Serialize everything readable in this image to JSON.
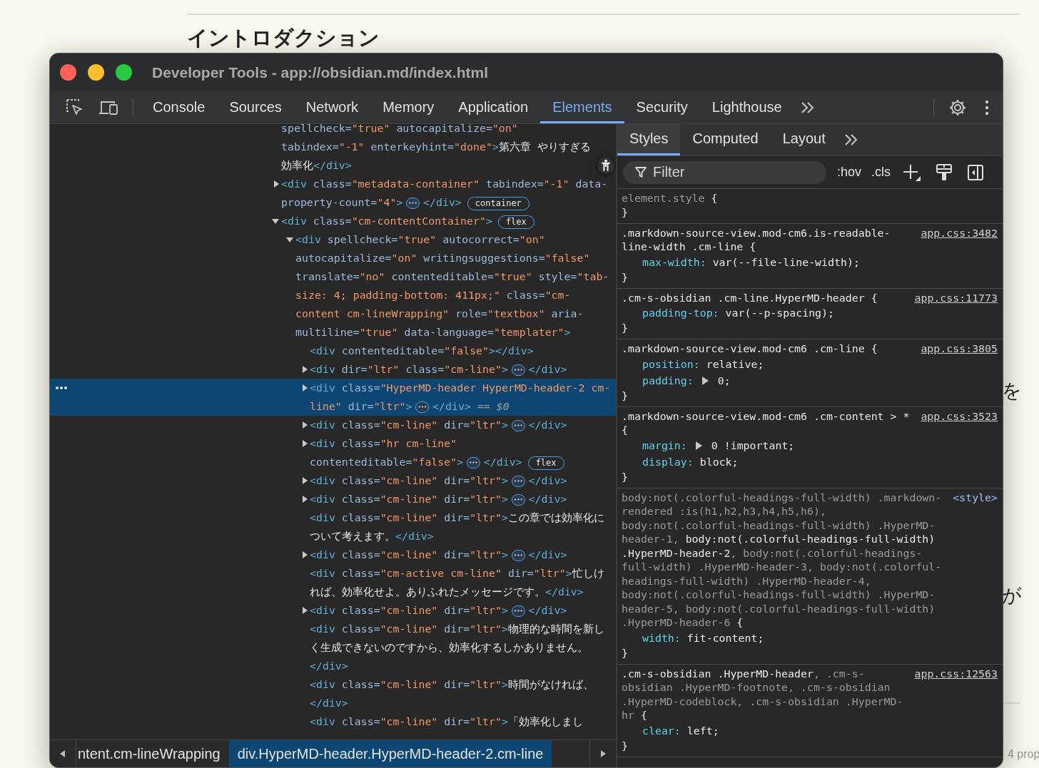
{
  "page": {
    "heading": "イントロダクション",
    "fragments": [
      "を",
      "が"
    ],
    "footer": "4 prop"
  },
  "window": {
    "title": "Developer Tools - app://obsidian.md/index.html"
  },
  "toolbar": {
    "tabs": [
      {
        "label": "Console",
        "selected": false
      },
      {
        "label": "Sources",
        "selected": false
      },
      {
        "label": "Network",
        "selected": false
      },
      {
        "label": "Memory",
        "selected": false
      },
      {
        "label": "Application",
        "selected": false
      },
      {
        "label": "Elements",
        "selected": true
      },
      {
        "label": "Security",
        "selected": false
      },
      {
        "label": "Lighthouse",
        "selected": false
      }
    ]
  },
  "dom": {
    "nodes": [
      {
        "kind": "leaf",
        "selected": false,
        "open": [
          {
            "kind": "attr",
            "text": "spellcheck="
          },
          {
            "kind": "value",
            "text": "\"true\""
          },
          {
            "kind": "attr",
            "text": " autocapitalize="
          },
          {
            "kind": "value",
            "text": "\"on\""
          },
          {
            "kind": "attr",
            "text": " tabindex="
          },
          {
            "kind": "value",
            "text": "\"-1\""
          },
          {
            "kind": "attr",
            "text": " enterkeyhint="
          },
          {
            "kind": "value",
            "text": "\"done\""
          },
          {
            "kind": "tag",
            "text": ">"
          },
          {
            "kind": "text",
            "text": "第六章 やりすぎる効率化"
          },
          {
            "kind": "tag",
            "text": "</div>"
          }
        ]
      },
      {
        "kind": "element",
        "expanded": false,
        "selected": false,
        "open": [
          {
            "kind": "tag",
            "text": "<div"
          },
          {
            "kind": "attr",
            "text": " class="
          },
          {
            "kind": "value",
            "text": "\"metadata-container\""
          },
          {
            "kind": "attr",
            "text": " tabindex="
          },
          {
            "kind": "value",
            "text": "\"-1\""
          },
          {
            "kind": "attr",
            "text": " data-property-count="
          },
          {
            "kind": "value",
            "text": "\"4\""
          },
          {
            "kind": "tag",
            "text": ">"
          }
        ],
        "ellipsis": "•••",
        "close": "</div>",
        "badge": "container"
      },
      {
        "kind": "element",
        "expanded": true,
        "selected": false,
        "open": [
          {
            "kind": "tag",
            "text": "<div"
          },
          {
            "kind": "attr",
            "text": " class="
          },
          {
            "kind": "value",
            "text": "\"cm-contentContainer\""
          },
          {
            "kind": "tag",
            "text": ">"
          }
        ],
        "badge": "flex",
        "children": [
          {
            "kind": "element",
            "expanded": true,
            "selected": false,
            "open": [
              {
                "kind": "tag",
                "text": "<div"
              },
              {
                "kind": "attr",
                "text": " spellcheck="
              },
              {
                "kind": "value",
                "text": "\"true\""
              },
              {
                "kind": "attr",
                "text": " autocorrect="
              },
              {
                "kind": "value",
                "text": "\"on\""
              },
              {
                "kind": "attr",
                "text": " autocapitalize="
              },
              {
                "kind": "value",
                "text": "\"on\""
              },
              {
                "kind": "attr",
                "text": " writingsuggestions="
              },
              {
                "kind": "value",
                "text": "\"false\""
              },
              {
                "kind": "attr",
                "text": " translate="
              },
              {
                "kind": "value",
                "text": "\"no\""
              },
              {
                "kind": "attr",
                "text": " contenteditable="
              },
              {
                "kind": "value",
                "text": "\"true\""
              },
              {
                "kind": "attr",
                "text": " style="
              },
              {
                "kind": "value",
                "text": "\"tab-size: 4; padding-bottom: 411px;\""
              },
              {
                "kind": "attr",
                "text": " class="
              },
              {
                "kind": "value",
                "text": "\"cm-content cm-lineWrapping\""
              },
              {
                "kind": "attr",
                "text": " role="
              },
              {
                "kind": "value",
                "text": "\"textbox\""
              },
              {
                "kind": "attr",
                "text": " aria-multiline="
              },
              {
                "kind": "value",
                "text": "\"true\""
              },
              {
                "kind": "attr",
                "text": " data-language="
              },
              {
                "kind": "value",
                "text": "\"templater\""
              },
              {
                "kind": "tag",
                "text": ">"
              }
            ],
            "children": [
              {
                "kind": "leaf",
                "selected": false,
                "open": [
                  {
                    "kind": "tag",
                    "text": "<div"
                  },
                  {
                    "kind": "attr",
                    "text": " contenteditable="
                  },
                  {
                    "kind": "value",
                    "text": "\"false\""
                  },
                  {
                    "kind": "tag",
                    "text": "></div>"
                  }
                ]
              },
              {
                "kind": "element",
                "expanded": false,
                "selected": false,
                "open": [
                  {
                    "kind": "tag",
                    "text": "<div"
                  },
                  {
                    "kind": "attr",
                    "text": " dir="
                  },
                  {
                    "kind": "value",
                    "text": "\"ltr\""
                  },
                  {
                    "kind": "attr",
                    "text": " class="
                  },
                  {
                    "kind": "value",
                    "text": "\"cm-line\""
                  },
                  {
                    "kind": "tag",
                    "text": ">"
                  }
                ],
                "ellipsis": "•••",
                "close": "</div>"
              },
              {
                "kind": "element",
                "expanded": false,
                "selected": true,
                "open": [
                  {
                    "kind": "tag",
                    "text": "<div"
                  },
                  {
                    "kind": "attr",
                    "text": " class="
                  },
                  {
                    "kind": "value",
                    "text": "\"HyperMD-header HyperMD-header-2 cm-line\""
                  },
                  {
                    "kind": "attr",
                    "text": " dir="
                  },
                  {
                    "kind": "value",
                    "text": "\"ltr\""
                  },
                  {
                    "kind": "tag",
                    "text": ">"
                  }
                ],
                "ellipsis": "•••",
                "close": "</div>",
                "marker": "== $0"
              },
              {
                "kind": "element",
                "expanded": false,
                "selected": false,
                "open": [
                  {
                    "kind": "tag",
                    "text": "<div"
                  },
                  {
                    "kind": "attr",
                    "text": " class="
                  },
                  {
                    "kind": "value",
                    "text": "\"cm-line\""
                  },
                  {
                    "kind": "attr",
                    "text": " dir="
                  },
                  {
                    "kind": "value",
                    "text": "\"ltr\""
                  },
                  {
                    "kind": "tag",
                    "text": ">"
                  }
                ],
                "ellipsis": "•••",
                "close": "</div>"
              },
              {
                "kind": "element",
                "expanded": false,
                "selected": false,
                "open": [
                  {
                    "kind": "tag",
                    "text": "<div"
                  },
                  {
                    "kind": "attr",
                    "text": " class="
                  },
                  {
                    "kind": "value",
                    "text": "\"hr cm-line\""
                  },
                  {
                    "kind": "attr",
                    "text": " contenteditable="
                  },
                  {
                    "kind": "value",
                    "text": "\"false\""
                  },
                  {
                    "kind": "tag",
                    "text": ">"
                  }
                ],
                "ellipsis": "•••",
                "close": "</div>",
                "badge": "flex"
              },
              {
                "kind": "element",
                "expanded": false,
                "selected": false,
                "open": [
                  {
                    "kind": "tag",
                    "text": "<div"
                  },
                  {
                    "kind": "attr",
                    "text": " class="
                  },
                  {
                    "kind": "value",
                    "text": "\"cm-line\""
                  },
                  {
                    "kind": "attr",
                    "text": " dir="
                  },
                  {
                    "kind": "value",
                    "text": "\"ltr\""
                  },
                  {
                    "kind": "tag",
                    "text": ">"
                  }
                ],
                "ellipsis": "•••",
                "close": "</div>"
              },
              {
                "kind": "element",
                "expanded": false,
                "selected": false,
                "open": [
                  {
                    "kind": "tag",
                    "text": "<div"
                  },
                  {
                    "kind": "attr",
                    "text": " class="
                  },
                  {
                    "kind": "value",
                    "text": "\"cm-line\""
                  },
                  {
                    "kind": "attr",
                    "text": " dir="
                  },
                  {
                    "kind": "value",
                    "text": "\"ltr\""
                  },
                  {
                    "kind": "tag",
                    "text": ">"
                  }
                ],
                "ellipsis": "•••",
                "close": "</div>"
              },
              {
                "kind": "leaf",
                "selected": false,
                "open": [
                  {
                    "kind": "tag",
                    "text": "<div"
                  },
                  {
                    "kind": "attr",
                    "text": " class="
                  },
                  {
                    "kind": "value",
                    "text": "\"cm-line\""
                  },
                  {
                    "kind": "attr",
                    "text": " dir="
                  },
                  {
                    "kind": "value",
                    "text": "\"ltr\""
                  },
                  {
                    "kind": "tag",
                    "text": ">"
                  },
                  {
                    "kind": "text",
                    "text": "この章では効率化について考えます。"
                  },
                  {
                    "kind": "tag",
                    "text": "</div>"
                  }
                ]
              },
              {
                "kind": "element",
                "expanded": false,
                "selected": false,
                "open": [
                  {
                    "kind": "tag",
                    "text": "<div"
                  },
                  {
                    "kind": "attr",
                    "text": " class="
                  },
                  {
                    "kind": "value",
                    "text": "\"cm-line\""
                  },
                  {
                    "kind": "attr",
                    "text": " dir="
                  },
                  {
                    "kind": "value",
                    "text": "\"ltr\""
                  },
                  {
                    "kind": "tag",
                    "text": ">"
                  }
                ],
                "ellipsis": "•••",
                "close": "</div>"
              },
              {
                "kind": "leaf",
                "selected": false,
                "open": [
                  {
                    "kind": "tag",
                    "text": "<div"
                  },
                  {
                    "kind": "attr",
                    "text": " class="
                  },
                  {
                    "kind": "value",
                    "text": "\"cm-active cm-line\""
                  },
                  {
                    "kind": "attr",
                    "text": " dir="
                  },
                  {
                    "kind": "value",
                    "text": "\"ltr\""
                  },
                  {
                    "kind": "tag",
                    "text": ">"
                  },
                  {
                    "kind": "text",
                    "text": "忙しければ、効率化せよ。ありふれたメッセージです。"
                  },
                  {
                    "kind": "tag",
                    "text": "</div>"
                  }
                ]
              },
              {
                "kind": "element",
                "expanded": false,
                "selected": false,
                "open": [
                  {
                    "kind": "tag",
                    "text": "<div"
                  },
                  {
                    "kind": "attr",
                    "text": " class="
                  },
                  {
                    "kind": "value",
                    "text": "\"cm-line\""
                  },
                  {
                    "kind": "attr",
                    "text": " dir="
                  },
                  {
                    "kind": "value",
                    "text": "\"ltr\""
                  },
                  {
                    "kind": "tag",
                    "text": ">"
                  }
                ],
                "ellipsis": "•••",
                "close": "</div>"
              },
              {
                "kind": "leaf",
                "selected": false,
                "open": [
                  {
                    "kind": "tag",
                    "text": "<div"
                  },
                  {
                    "kind": "attr",
                    "text": " class="
                  },
                  {
                    "kind": "value",
                    "text": "\"cm-line\""
                  },
                  {
                    "kind": "attr",
                    "text": " dir="
                  },
                  {
                    "kind": "value",
                    "text": "\"ltr\""
                  },
                  {
                    "kind": "tag",
                    "text": ">"
                  },
                  {
                    "kind": "text",
                    "text": "物理的な時間を新しく生成できないのですから、効率化するしかありません。"
                  },
                  {
                    "kind": "tag",
                    "text": "</div>"
                  }
                ]
              },
              {
                "kind": "leaf",
                "selected": false,
                "open": [
                  {
                    "kind": "tag",
                    "text": "<div"
                  },
                  {
                    "kind": "attr",
                    "text": " class="
                  },
                  {
                    "kind": "value",
                    "text": "\"cm-line\""
                  },
                  {
                    "kind": "attr",
                    "text": " dir="
                  },
                  {
                    "kind": "value",
                    "text": "\"ltr\""
                  },
                  {
                    "kind": "tag",
                    "text": ">"
                  },
                  {
                    "kind": "text",
                    "text": "時間がなければ、"
                  },
                  {
                    "kind": "tag",
                    "text": "</div>"
                  }
                ]
              },
              {
                "kind": "leaf",
                "selected": false,
                "open": [
                  {
                    "kind": "tag",
                    "text": "<div"
                  },
                  {
                    "kind": "attr",
                    "text": " class="
                  },
                  {
                    "kind": "value",
                    "text": "\"cm-line\""
                  },
                  {
                    "kind": "attr",
                    "text": " dir="
                  },
                  {
                    "kind": "value",
                    "text": "\"ltr\""
                  },
                  {
                    "kind": "tag",
                    "text": ">"
                  },
                  {
                    "kind": "text",
                    "text": "「効率化しまし"
                  }
                ]
              }
            ]
          }
        ]
      }
    ]
  },
  "breadcrumbs": [
    {
      "text": "ntent.cm-lineWrapping",
      "selected": false
    },
    {
      "text": "div.HyperMD-header.HyperMD-header-2.cm-line",
      "selected": true
    }
  ],
  "styles": {
    "tabs": [
      {
        "label": "Styles",
        "selected": true
      },
      {
        "label": "Computed",
        "selected": false
      },
      {
        "label": "Layout",
        "selected": false
      }
    ],
    "filter": {
      "placeholder": "Filter"
    },
    "hov": ":hov",
    "cls": ".cls",
    "rules": [
      {
        "selector": [
          {
            "text": "element.style",
            "matched": false
          },
          {
            "text": " {",
            "matched": true
          }
        ],
        "close": "}"
      },
      {
        "selector": [
          {
            "text": ".markdown-source-view.mod-cm6.is-readable-line-width .cm-line {",
            "matched": true
          }
        ],
        "source": {
          "kind": "link",
          "text": "app.css:3482"
        },
        "props": [
          {
            "name": "max-width:",
            "value": "var(--file-line-width);",
            "expandable": false
          }
        ],
        "close": "}"
      },
      {
        "selector": [
          {
            "text": ".cm-s-obsidian .cm-line.HyperMD-header {",
            "matched": true
          }
        ],
        "source": {
          "kind": "link",
          "text": "app.css:11773"
        },
        "props": [
          {
            "name": "padding-top:",
            "value": "var(--p-spacing);",
            "expandable": false
          }
        ],
        "close": "}"
      },
      {
        "selector": [
          {
            "text": ".markdown-source-view.mod-cm6 .cm-line {",
            "matched": true
          }
        ],
        "source": {
          "kind": "link",
          "text": "app.css:3805"
        },
        "props": [
          {
            "name": "position:",
            "value": "relative;",
            "expandable": false
          },
          {
            "name": "padding:",
            "value": "0;",
            "expandable": true
          }
        ],
        "close": "}"
      },
      {
        "selector": [
          {
            "text": ".markdown-source-view.mod-cm6 .cm-content > * {",
            "matched": true
          }
        ],
        "source": {
          "kind": "link",
          "text": "app.css:3523"
        },
        "props": [
          {
            "name": "margin:",
            "value": "0 !important;",
            "expandable": true
          },
          {
            "name": "display:",
            "value": "block;",
            "expandable": false
          }
        ],
        "close": "}"
      },
      {
        "selector": [
          {
            "text": "body:not(.colorful-headings-full-width) .markdown-rendered :is(h1,h2,h3,h4,h5,h6), body:not(.colorful-headings-full-width) .HyperMD-header-1, ",
            "matched": false
          },
          {
            "text": "body:not(.colorful-headings-full-width) .HyperMD-header-2",
            "matched": true
          },
          {
            "text": ", body:not(.colorful-headings-full-width) .HyperMD-header-3, body:not(.colorful-headings-full-width) .HyperMD-header-4, body:not(.colorful-headings-full-width) .HyperMD-header-5, body:not(.colorful-headings-full-width) .HyperMD-header-6",
            "matched": false
          },
          {
            "text": " {",
            "matched": true
          }
        ],
        "source": {
          "kind": "inline",
          "text": "<style>"
        },
        "props": [
          {
            "name": "width:",
            "value": "fit-content;",
            "expandable": false
          }
        ],
        "close": "}"
      },
      {
        "selector": [
          {
            "text": ".cm-s-obsidian .HyperMD-header",
            "matched": true
          },
          {
            "text": ", .cm-s-obsidian .HyperMD-footnote, .cm-s-obsidian .HyperMD-codeblock, .cm-s-obsidian .HyperMD-hr",
            "matched": false
          },
          {
            "text": " {",
            "matched": true
          }
        ],
        "source": {
          "kind": "link",
          "text": "app.css:12563"
        },
        "props": [
          {
            "name": "clear:",
            "value": "left;",
            "expandable": false
          }
        ],
        "close": "}"
      }
    ]
  }
}
